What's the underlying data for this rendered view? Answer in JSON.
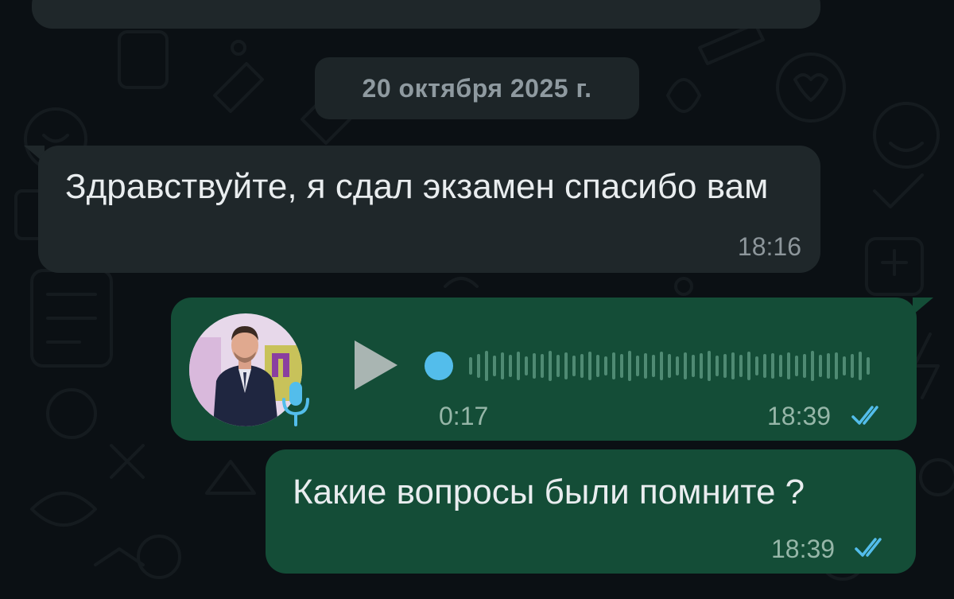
{
  "date_divider": "20 октября 2025 г.",
  "messages": [
    {
      "direction": "incoming",
      "type": "text",
      "text": "Здравствуйте, я сдал экзамен спасибо вам",
      "time": "18:16"
    },
    {
      "direction": "outgoing",
      "type": "voice",
      "duration": "0:17",
      "time": "18:39",
      "status": "read",
      "icons": [
        "play-icon",
        "microphone-icon",
        "double-check-icon"
      ]
    },
    {
      "direction": "outgoing",
      "type": "text",
      "text": "Какие вопросы были помните ?",
      "time": "18:39",
      "status": "read"
    }
  ],
  "colors": {
    "background": "#0b1014",
    "incoming_bubble": "#1f272a",
    "outgoing_bubble": "#144d37",
    "read_check": "#53bdeb",
    "voice_progress_dot": "#53bdeb"
  }
}
